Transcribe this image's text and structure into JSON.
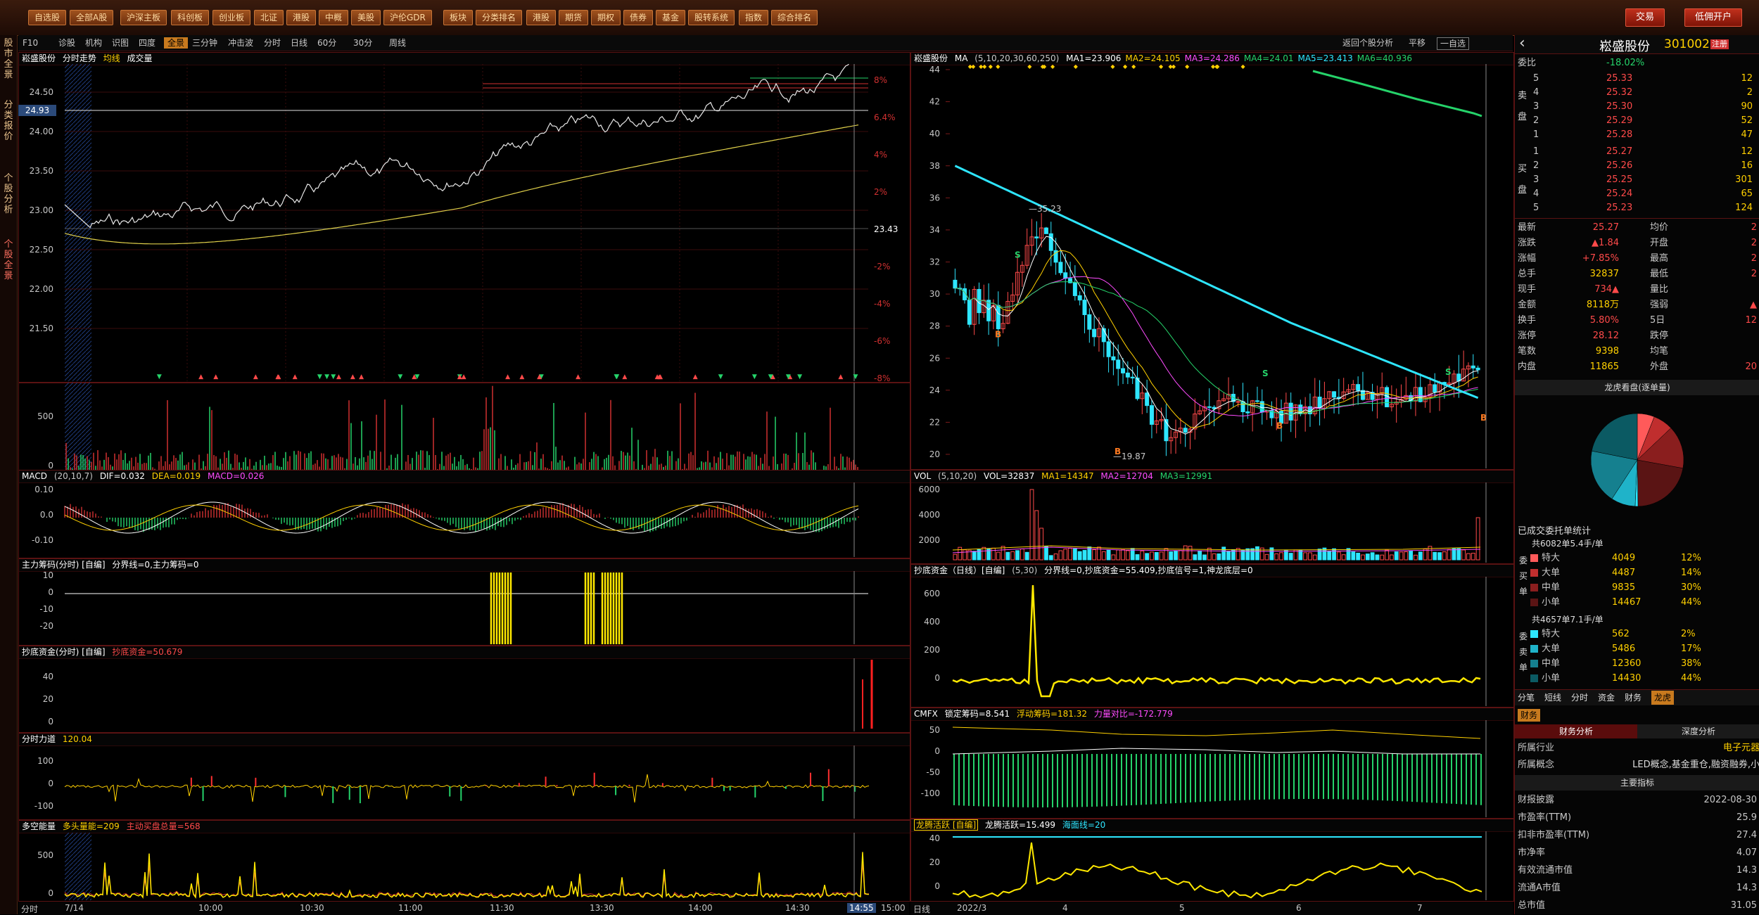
{
  "toolbar": {
    "left_buttons": [
      "自选股",
      "全部A股",
      "沪深主板",
      "科创板",
      "创业板",
      "北证",
      "港股",
      "中概",
      "美股",
      "沪伦GDR",
      "板块",
      "分类排名",
      "港股",
      "期货",
      "期权",
      "债券",
      "基金",
      "股转系统",
      "指数",
      "综合排名"
    ],
    "trade_label": "交易",
    "margin_label": "低佣开户"
  },
  "left_tabs": [
    "股市全景",
    "分类报价",
    "个股分析",
    "个股全景"
  ],
  "subbar": {
    "items": [
      "F10",
      "诊股",
      "机构",
      "识图",
      "四度",
      "全景",
      "三分钟",
      "冲击波",
      "分时",
      "日线",
      "60分",
      "30分",
      "周线"
    ],
    "active": "全景",
    "right_items": [
      "返回个股分析",
      "平移",
      "一自选"
    ]
  },
  "intraday": {
    "title": "崧盛股份",
    "subtitle": "分时走势",
    "legend_avg": "均线",
    "legend_vol": "成交量",
    "price_ticks": [
      "24.50",
      "24.00",
      "23.50",
      "23.00",
      "22.50",
      "22.00",
      "21.50"
    ],
    "price_marker": "24.93",
    "pct_ticks": [
      "8%",
      "6.4%",
      "4%",
      "2%",
      "23.43",
      "-2%",
      "-4%",
      "-6%",
      "-8%"
    ],
    "vol_ticks": [
      "500",
      "0"
    ],
    "time_labels": [
      "7/14",
      "10:00",
      "10:30",
      "11:00",
      "11:30",
      "13:30",
      "14:00",
      "14:30",
      "14:55",
      "15:00"
    ],
    "bottom_left": "分时"
  },
  "macd": {
    "title": "MACD",
    "params": "(20,10,7)",
    "dif": "DIF=0.032",
    "dea": "DEA=0.019",
    "macd": "MACD=0.026",
    "ticks": [
      "0.10",
      "0.0",
      "-0.10"
    ]
  },
  "zlcm": {
    "title": "主力筹码(分时) [自编]",
    "desc": "分界线=0,主力筹码=0",
    "ticks": [
      "10",
      "0",
      "-10",
      "-20"
    ]
  },
  "cdzj": {
    "title": "抄底资金(分时) [自编]",
    "desc": "抄底资金=50.679",
    "ticks": [
      "40",
      "20",
      "0"
    ]
  },
  "fsld": {
    "title": "分时力道",
    "value": "120.04",
    "ticks": [
      "100",
      "0",
      "-100"
    ]
  },
  "dkn": {
    "title": "多空能量",
    "bull": "多头量能=209",
    "bear": "主动买盘总量=568",
    "ticks": [
      "500",
      "0"
    ]
  },
  "daily": {
    "title": "崧盛股份",
    "ma_label": "MA",
    "ma_params": "(5,10,20,30,60,250)",
    "ma_values": [
      "MA1=23.906",
      "MA2=24.105",
      "MA3=24.286",
      "MA4=24.01",
      "MA5=23.413",
      "MA6=40.936"
    ],
    "ma_colors": [
      "#ffffff",
      "#ffd000",
      "#ff4cff",
      "#25d36a",
      "#2ee6ff",
      "#25d36a"
    ],
    "price_ticks": [
      "44",
      "42",
      "40",
      "38",
      "36",
      "34",
      "32",
      "30",
      "28",
      "26",
      "24",
      "22",
      "20"
    ],
    "high_label": "35.23",
    "low_label": "19.87",
    "month_labels": [
      "2022/3",
      "4",
      "5",
      "6",
      "7"
    ],
    "bottom_left": "日线",
    "right_tools": [
      "返回个股分析",
      "平移",
      "一自选"
    ]
  },
  "vol": {
    "title": "VOL",
    "params": "(5,10,20)",
    "values": [
      "VOL=32837",
      "MA1=14347",
      "MA2=12704",
      "MA3=12991"
    ],
    "ticks": [
      "6000",
      "4000",
      "2000"
    ]
  },
  "cdzj_daily": {
    "title": "抄底资金（日线）[自编]",
    "params": "(5,30)",
    "desc": "分界线=0,抄底资金=55.409,抄底信号=1,神龙底层=0",
    "ticks": [
      "600",
      "400",
      "200",
      "0"
    ]
  },
  "cmfx": {
    "title": "CMFX",
    "values": [
      "锁定筹码=8.541",
      "浮动筹码=181.32",
      "力量对比=-172.779"
    ],
    "ticks": [
      "50",
      "0",
      "-50",
      "-100"
    ]
  },
  "lths": {
    "title": "龙腾活跃 [自编]",
    "values": [
      "龙腾活跃=15.499",
      "海面线=20"
    ],
    "ticks": [
      "40",
      "20",
      "0"
    ]
  },
  "quote": {
    "name": "崧盛股份",
    "code": "301002",
    "badge": "注册",
    "weibi_label": "委比",
    "weibi_value": "-18.02%",
    "sell": [
      [
        "5",
        "25.33",
        "12"
      ],
      [
        "4",
        "25.32",
        "2"
      ],
      [
        "3",
        "25.30",
        "90"
      ],
      [
        "2",
        "25.29",
        "52"
      ],
      [
        "1",
        "25.28",
        "47"
      ]
    ],
    "buy": [
      [
        "1",
        "25.27",
        "12"
      ],
      [
        "2",
        "25.26",
        "16"
      ],
      [
        "3",
        "25.25",
        "301"
      ],
      [
        "4",
        "25.24",
        "65"
      ],
      [
        "5",
        "25.23",
        "124"
      ]
    ],
    "sell_label": "卖盘",
    "buy_label": "买盘",
    "stats": [
      [
        "最新",
        "25.27",
        "均价",
        "2"
      ],
      [
        "涨跌",
        "▲1.84",
        "开盘",
        "2"
      ],
      [
        "涨幅",
        "+7.85%",
        "最高",
        "2"
      ],
      [
        "总手",
        "32837",
        "最低",
        "2"
      ],
      [
        "现手",
        "734▲",
        "量比",
        ""
      ],
      [
        "金额",
        "8118万",
        "强弱",
        "▲"
      ],
      [
        "换手",
        "5.80%",
        "5日",
        "12"
      ],
      [
        "涨停",
        "28.12",
        "跌停",
        ""
      ],
      [
        "笔数",
        "9398",
        "均笔",
        ""
      ],
      [
        "内盘",
        "11865",
        "外盘",
        "20"
      ]
    ]
  },
  "dragon": {
    "title": "龙虎看盘(逐单量)",
    "pie": [
      {
        "label": "特大买",
        "value": 12,
        "color": "#ff5a5a"
      },
      {
        "label": "大买",
        "value": 14,
        "color": "#c02e2e"
      },
      {
        "label": "中买",
        "value": 30,
        "color": "#8a1e1e"
      },
      {
        "label": "小买",
        "value": 44,
        "color": "#5a1414"
      },
      {
        "label": "特大卖",
        "value": 2,
        "color": "#2ee6ff"
      },
      {
        "label": "大卖",
        "value": 17,
        "color": "#1fb3c9"
      },
      {
        "label": "中卖",
        "value": 38,
        "color": "#15808f"
      },
      {
        "label": "小卖",
        "value": 44,
        "color": "#0b5a63"
      }
    ],
    "entrust_title": "已成交委托单统计",
    "buy_total": "共6082单5.4手/单",
    "buy_rows": [
      [
        "特大",
        "4049",
        "12%"
      ],
      [
        "大单",
        "4487",
        "14%"
      ],
      [
        "中单",
        "9835",
        "30%"
      ],
      [
        "小单",
        "14467",
        "44%"
      ]
    ],
    "sell_total": "共4657单7.1手/单",
    "sell_rows": [
      [
        "特大",
        "562",
        "2%"
      ],
      [
        "大单",
        "5486",
        "17%"
      ],
      [
        "中单",
        "12360",
        "38%"
      ],
      [
        "小单",
        "14430",
        "44%"
      ]
    ],
    "buy_side_label": "委买单",
    "sell_side_label": "委卖单",
    "tabs": [
      "分笔",
      "短线",
      "分时",
      "资金",
      "财务",
      "龙虎"
    ],
    "active_tab": "龙虎"
  },
  "finance": {
    "tab": "财务",
    "sub_tabs": [
      "财务分析",
      "深度分析"
    ],
    "industry_label": "所属行业",
    "industry": "电子元器",
    "concept_label": "所属概念",
    "concept": "LED概念,基金重仓,融资融券,小",
    "main_title": "主要指标",
    "rows": [
      [
        "财报披露",
        "2022-08-30"
      ],
      [
        "市盈率(TTM)",
        "25.9"
      ],
      [
        "扣非市盈率(TTM)",
        "27.4"
      ],
      [
        "市净率",
        "4.07"
      ],
      [
        "有效流通市值",
        "14.3"
      ],
      [
        "流通A市值",
        "14.3"
      ],
      [
        "总市值",
        "31.05"
      ]
    ]
  }
}
